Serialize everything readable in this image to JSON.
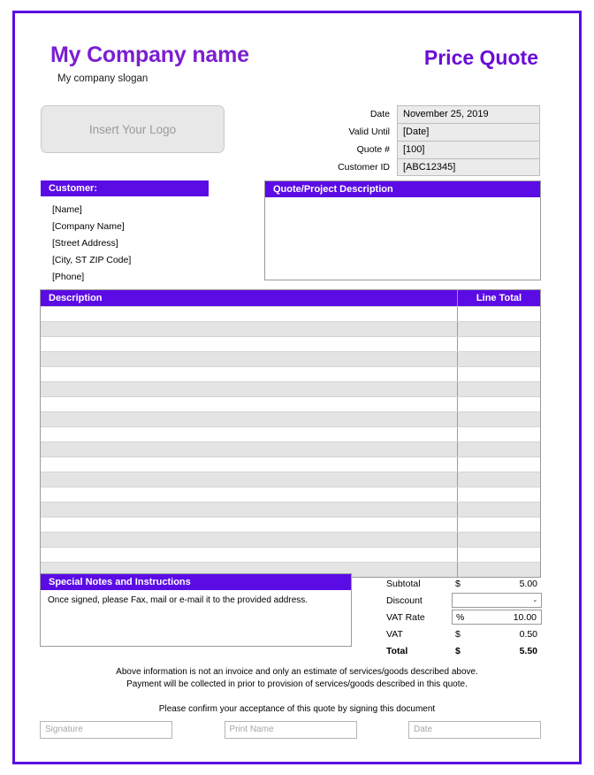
{
  "document": {
    "title": "Price Quote",
    "company_name": "My Company name",
    "company_slogan": "My company slogan",
    "logo_placeholder": "Insert Your Logo",
    "accent_color": "#5B0CE5",
    "title_color": "#6A0DD6",
    "company_name_color": "#7B1FD0"
  },
  "meta": {
    "rows": [
      {
        "label": "Date",
        "value": "November 25, 2019"
      },
      {
        "label": "Valid Until",
        "value": "[Date]"
      },
      {
        "label": "Quote #",
        "value": "[100]"
      },
      {
        "label": "Customer ID",
        "value": "[ABC12345]"
      }
    ]
  },
  "customer": {
    "heading": "Customer:",
    "lines": [
      "[Name]",
      "[Company Name]",
      "[Street Address]",
      "[City, ST  ZIP Code]",
      "[Phone]"
    ]
  },
  "quote_description": {
    "heading": "Quote/Project Description",
    "body": ""
  },
  "items_table": {
    "columns": [
      "Description",
      "Line Total"
    ],
    "rows": [
      {
        "description": "",
        "line_total": ""
      },
      {
        "description": "",
        "line_total": ""
      },
      {
        "description": "",
        "line_total": ""
      },
      {
        "description": "",
        "line_total": ""
      },
      {
        "description": "",
        "line_total": ""
      },
      {
        "description": "",
        "line_total": ""
      },
      {
        "description": "",
        "line_total": ""
      },
      {
        "description": "",
        "line_total": ""
      },
      {
        "description": "",
        "line_total": ""
      },
      {
        "description": "",
        "line_total": ""
      },
      {
        "description": "",
        "line_total": ""
      },
      {
        "description": "",
        "line_total": ""
      },
      {
        "description": "",
        "line_total": ""
      },
      {
        "description": "",
        "line_total": ""
      },
      {
        "description": "",
        "line_total": ""
      },
      {
        "description": "",
        "line_total": ""
      },
      {
        "description": "",
        "line_total": ""
      },
      {
        "description": "",
        "line_total": ""
      }
    ]
  },
  "notes": {
    "heading": "Special Notes and Instructions",
    "text": "Once signed, please Fax, mail or e-mail it to the provided address."
  },
  "totals": {
    "subtotal": {
      "label": "Subtotal",
      "currency": "$",
      "value": "5.00"
    },
    "discount": {
      "label": "Discount",
      "currency": "",
      "value": "-"
    },
    "vat_rate": {
      "label": "VAT Rate",
      "currency": "%",
      "value": "10.00"
    },
    "vat": {
      "label": "VAT",
      "currency": "$",
      "value": "0.50"
    },
    "total": {
      "label": "Total",
      "currency": "$",
      "value": "5.50"
    }
  },
  "footer": {
    "line1": "Above information is not an invoice and only an estimate of services/goods described above.",
    "line2": "Payment will be collected in prior to provision of services/goods described in this quote.",
    "line3": "Please confirm your acceptance of this quote by signing this document",
    "signature_placeholder": "Signature",
    "print_name_placeholder": "Print Name",
    "date_placeholder": "Date"
  }
}
